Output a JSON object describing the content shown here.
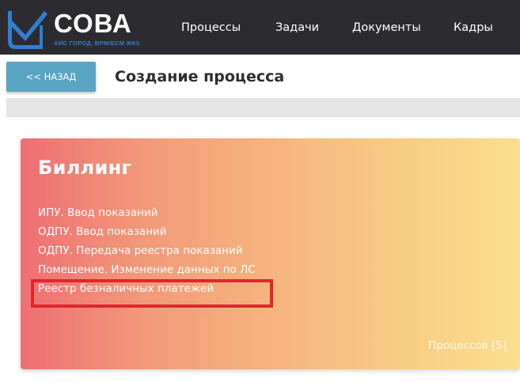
{
  "header": {
    "logo": {
      "title": "СОВА",
      "subtitle": "АИС ГОРОД. BPM/ECM ЖКХ",
      "icon": "owl-logo-icon"
    },
    "nav": [
      {
        "label": "Процессы"
      },
      {
        "label": "Задачи"
      },
      {
        "label": "Документы"
      },
      {
        "label": "Кадры"
      }
    ]
  },
  "toolbar": {
    "back_label": "<< НАЗАД",
    "page_title": "Создание процесса"
  },
  "card": {
    "title": "Биллинг",
    "items": [
      {
        "label": "ИПУ. Ввод показаний"
      },
      {
        "label": "ОДПУ. Ввод показаний"
      },
      {
        "label": "ОДПУ. Передача реестра показаний"
      },
      {
        "label": "Помещение. Изменение данных по ЛС"
      },
      {
        "label": "Реестр безналичных платежей"
      }
    ],
    "count_label": "Процессов [5]"
  },
  "colors": {
    "topbar": "#2c2c30",
    "accent_blue": "#2f7fd3",
    "back_button": "#5aa4c3",
    "highlight": "#e0262c",
    "card_gradient_start": "#ef6e74",
    "card_gradient_end": "#fadf8f"
  }
}
